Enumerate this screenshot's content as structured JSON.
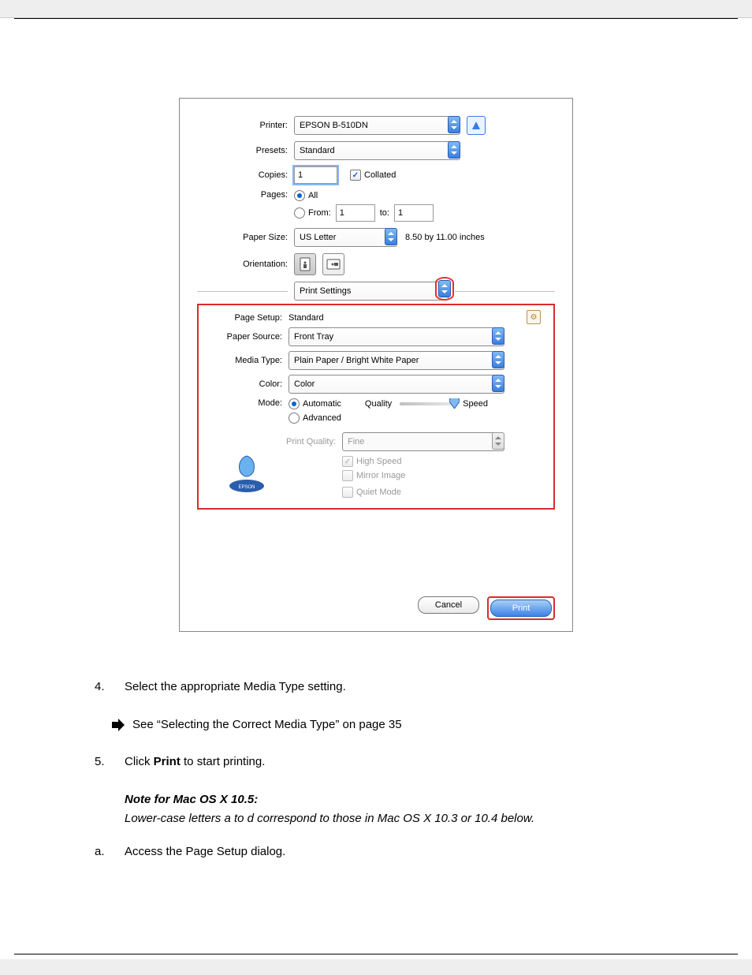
{
  "dialog": {
    "printer_label": "Printer:",
    "printer_value": "EPSON B-510DN",
    "presets_label": "Presets:",
    "presets_value": "Standard",
    "copies_label": "Copies:",
    "copies_value": "1",
    "collated_label": "Collated",
    "pages_label": "Pages:",
    "pages_all_label": "All",
    "pages_from_label": "From:",
    "pages_from_value": "1",
    "pages_to_label": "to:",
    "pages_to_value": "1",
    "paper_size_label": "Paper Size:",
    "paper_size_value": "US Letter",
    "paper_size_dim": "8.50 by 11.00 inches",
    "orientation_label": "Orientation:",
    "panel_select_value": "Print Settings",
    "settings": {
      "page_setup_label": "Page Setup:",
      "page_setup_value": "Standard",
      "paper_source_label": "Paper Source:",
      "paper_source_value": "Front Tray",
      "media_type_label": "Media Type:",
      "media_type_value": "Plain Paper / Bright White Paper",
      "color_label": "Color:",
      "color_value": "Color",
      "mode_label": "Mode:",
      "mode_auto": "Automatic",
      "mode_advanced": "Advanced",
      "slider_quality": "Quality",
      "slider_speed": "Speed",
      "print_quality_label": "Print Quality:",
      "print_quality_value": "Fine",
      "high_speed": "High Speed",
      "mirror_image": "Mirror Image",
      "quiet_mode": "Quiet Mode"
    },
    "buttons": {
      "cancel": "Cancel",
      "print": "Print"
    }
  },
  "doc": {
    "step4_num": "4.",
    "step4_text": "Select the appropriate Media Type setting.",
    "step4_link": "See “Selecting the Correct Media Type” on page 35",
    "step5_num": "5.",
    "step5_text": "Click Print to start printing.",
    "note_title": "Note for Mac OS X 10.5:",
    "note_body": "Lower-case letters a to d correspond to those in Mac OS X 10.3 or 10.4 below.",
    "step_lower_num": "a.",
    "step_lower_text": "Access the Page Setup dialog."
  }
}
